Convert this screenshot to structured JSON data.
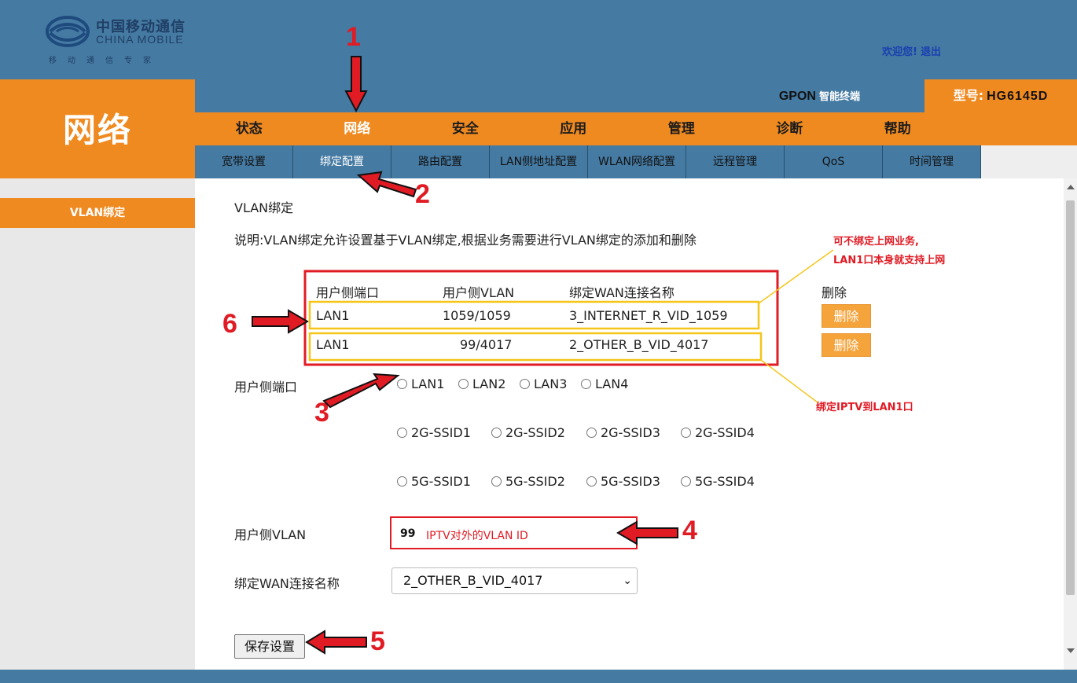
{
  "header": {
    "logo_cn": "中国移动通信",
    "logo_en": "CHINA MOBILE",
    "logo_slogan": "移动通信专家",
    "welcome": "欢迎您!",
    "logout": "退出",
    "product_name": "GPON",
    "product_sub": "智能终端",
    "model_label": "型号:",
    "model_value": "HG6145D",
    "section_title": "网络",
    "brand_color": "#ef8a21",
    "header_color": "#457aa2"
  },
  "main_nav": [
    "状态",
    "网络",
    "安全",
    "应用",
    "管理",
    "诊断",
    "帮助"
  ],
  "main_nav_active": "网络",
  "sub_nav": [
    "宽带设置",
    "绑定配置",
    "路由配置",
    "LAN侧地址配置",
    "WLAN网络配置",
    "远程管理",
    "QoS",
    "时间管理"
  ],
  "sub_nav_active": "绑定配置",
  "sidebar": {
    "items": [
      {
        "label": "VLAN绑定",
        "active": true
      }
    ]
  },
  "page": {
    "title": "VLAN绑定",
    "description": "说明:VLAN绑定允许设置基于VLAN绑定,根据业务需要进行VLAN绑定的添加和删除"
  },
  "binding_table": {
    "headers": [
      "用户侧端口",
      "用户侧VLAN",
      "绑定WAN连接名称",
      "删除"
    ],
    "rows": [
      {
        "port": "LAN1",
        "vlan": "1059/1059",
        "wan": "3_INTERNET_R_VID_1059",
        "delete": "删除"
      },
      {
        "port": "LAN1",
        "vlan": "99/4017",
        "wan": "2_OTHER_B_VID_4017",
        "delete": "删除"
      }
    ]
  },
  "form": {
    "port_label": "用户侧端口",
    "lan_ports": [
      "LAN1",
      "LAN2",
      "LAN3",
      "LAN4"
    ],
    "ssid_2g": [
      "2G-SSID1",
      "2G-SSID2",
      "2G-SSID3",
      "2G-SSID4"
    ],
    "ssid_5g": [
      "5G-SSID1",
      "5G-SSID2",
      "5G-SSID3",
      "5G-SSID4"
    ],
    "vlan_label": "用户侧VLAN",
    "vlan_value": "99",
    "wan_label": "绑定WAN连接名称",
    "wan_selected": "2_OTHER_B_VID_4017",
    "save_label": "保存设置"
  },
  "annotations": {
    "note_top_line1": "可不绑定上网业务,",
    "note_top_line2": "LAN1口本身就支持上网",
    "note_bottom": "绑定IPTV到LAN1口",
    "vlan_hint": "IPTV对外的VLAN ID",
    "step_numbers": [
      "1",
      "2",
      "3",
      "4",
      "5",
      "6"
    ],
    "annotation_color": "#e01b24",
    "highlight_color": "#f5c518"
  }
}
